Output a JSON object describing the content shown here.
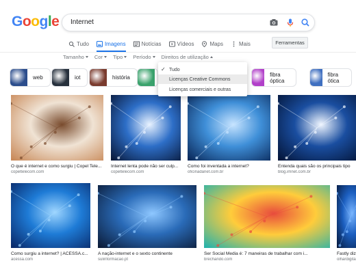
{
  "logo": {
    "letters": [
      "G",
      "o",
      "o",
      "g",
      "l",
      "e"
    ],
    "colors": [
      "#4285f4",
      "#ea4335",
      "#fbbc05",
      "#4285f4",
      "#34a853",
      "#ea4335"
    ]
  },
  "search": {
    "query": "Internet"
  },
  "tabs": [
    {
      "label": "Tudo",
      "icon": "search-icon",
      "active": false
    },
    {
      "label": "Imagens",
      "icon": "image-icon",
      "active": true
    },
    {
      "label": "Notícias",
      "icon": "news-icon",
      "active": false
    },
    {
      "label": "Vídeos",
      "icon": "video-icon",
      "active": false
    },
    {
      "label": "Maps",
      "icon": "map-pin-icon",
      "active": false
    },
    {
      "label": "Mais",
      "icon": "more-icon",
      "active": false
    }
  ],
  "tools_button": "Ferramentas",
  "filters": [
    {
      "label": "Tamanho"
    },
    {
      "label": "Cor"
    },
    {
      "label": "Tipo"
    },
    {
      "label": "Período"
    },
    {
      "label": "Direitos de utilização",
      "open": true
    }
  ],
  "dropdown": {
    "items": [
      {
        "label": "Tudo",
        "checked": true,
        "highlighted": false
      },
      {
        "label": "Licenças Creative Commons",
        "checked": false,
        "highlighted": true
      },
      {
        "label": "Licenças comerciais e outras",
        "checked": false,
        "highlighted": false
      }
    ]
  },
  "chips": [
    {
      "label": "web",
      "color": "#2b4d8c"
    },
    {
      "label": "iot",
      "color": "#26303c"
    },
    {
      "label": "história",
      "color": "#7a3b2e"
    },
    {
      "label": "",
      "color": "#3aa26c"
    },
    {
      "label": "fibra óptica",
      "color": "#b13fc9"
    },
    {
      "label": "fibra ótica",
      "color": "#3f6fc0"
    }
  ],
  "results": [
    {
      "caption": "O que é internet e como surgiu | Copel Tele...",
      "source": "copeltelecom.com",
      "colors": [
        "#c98a5a",
        "#f0e3d4",
        "#7a4c2e"
      ]
    },
    {
      "caption": "Internet lenta pode não ser culp...",
      "source": "copeltelecom.com",
      "colors": [
        "#0a1a3c",
        "#2d6ec7",
        "#e8f2ff"
      ]
    },
    {
      "caption": "Como foi inventada a internet?",
      "source": "oficinadanet.com.br",
      "colors": [
        "#0b2a5c",
        "#3f8fd8",
        "#c7e4ff"
      ]
    },
    {
      "caption": "Entenda quais são os principais tipo",
      "source": "blog.imnet.com.br",
      "colors": [
        "#04163a",
        "#1a4ea0",
        "#f0f6ff"
      ]
    },
    {
      "caption": "Como surgiu a internet? | ACESSA.c...",
      "source": "acessa.com",
      "colors": [
        "#0a2a6a",
        "#1e7bd6",
        "#9fd6ff"
      ]
    },
    {
      "caption": "A nação-internet e o sexto continente",
      "source": "sulinformacao.pt",
      "colors": [
        "#0c1d3a",
        "#2a6bb8",
        "#8ec7ff"
      ]
    },
    {
      "caption": "Ser Social Media é: 7 maneiras de trabalhar com i...",
      "source": "brechando.com",
      "colors": [
        "#2ab3a9",
        "#ffcc3b",
        "#e84c3d"
      ]
    },
    {
      "caption": "Fastly diz que qu",
      "source": "olhardigital.com.br",
      "colors": [
        "#051a3e",
        "#1c5fc0",
        "#7ab6ff"
      ]
    }
  ]
}
